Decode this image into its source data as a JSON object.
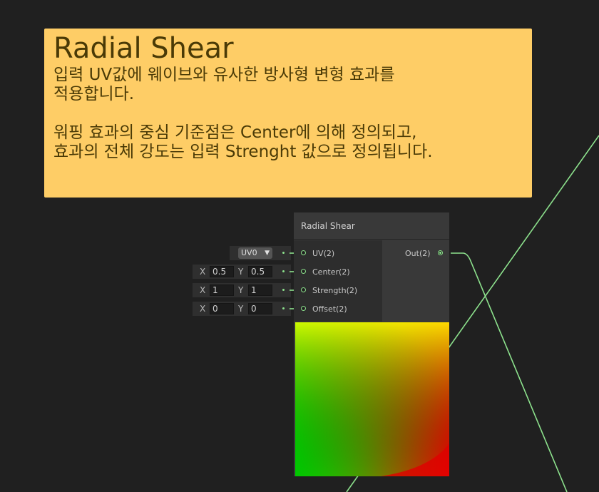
{
  "sticky_note": {
    "title": "Radial Shear",
    "body": "입력 UV값에 웨이브와 유사한 방사형 변형 효과를\n적용합니다.\n\n워핑 효과의 중심 기준점은 Center에 의해 정의되고,\n효과의 전체 강도는 입력 Strenght 값으로 정의됩니다."
  },
  "node": {
    "title": "Radial Shear",
    "inputs": [
      "UV(2)",
      "Center(2)",
      "Strength(2)",
      "Offset(2)"
    ],
    "output": "Out(2)"
  },
  "input_fields": {
    "uv_dropdown": "UV0",
    "center": {
      "x_label": "X",
      "x": "0.5",
      "y_label": "Y",
      "y": "0.5"
    },
    "strength": {
      "x_label": "X",
      "x": "1",
      "y_label": "Y",
      "y": "1"
    },
    "offset": {
      "x_label": "X",
      "x": "0",
      "y_label": "Y",
      "y": "0"
    }
  },
  "colors": {
    "background": "#202020",
    "sticky": "#fecd66",
    "wire": "#8de28d"
  }
}
